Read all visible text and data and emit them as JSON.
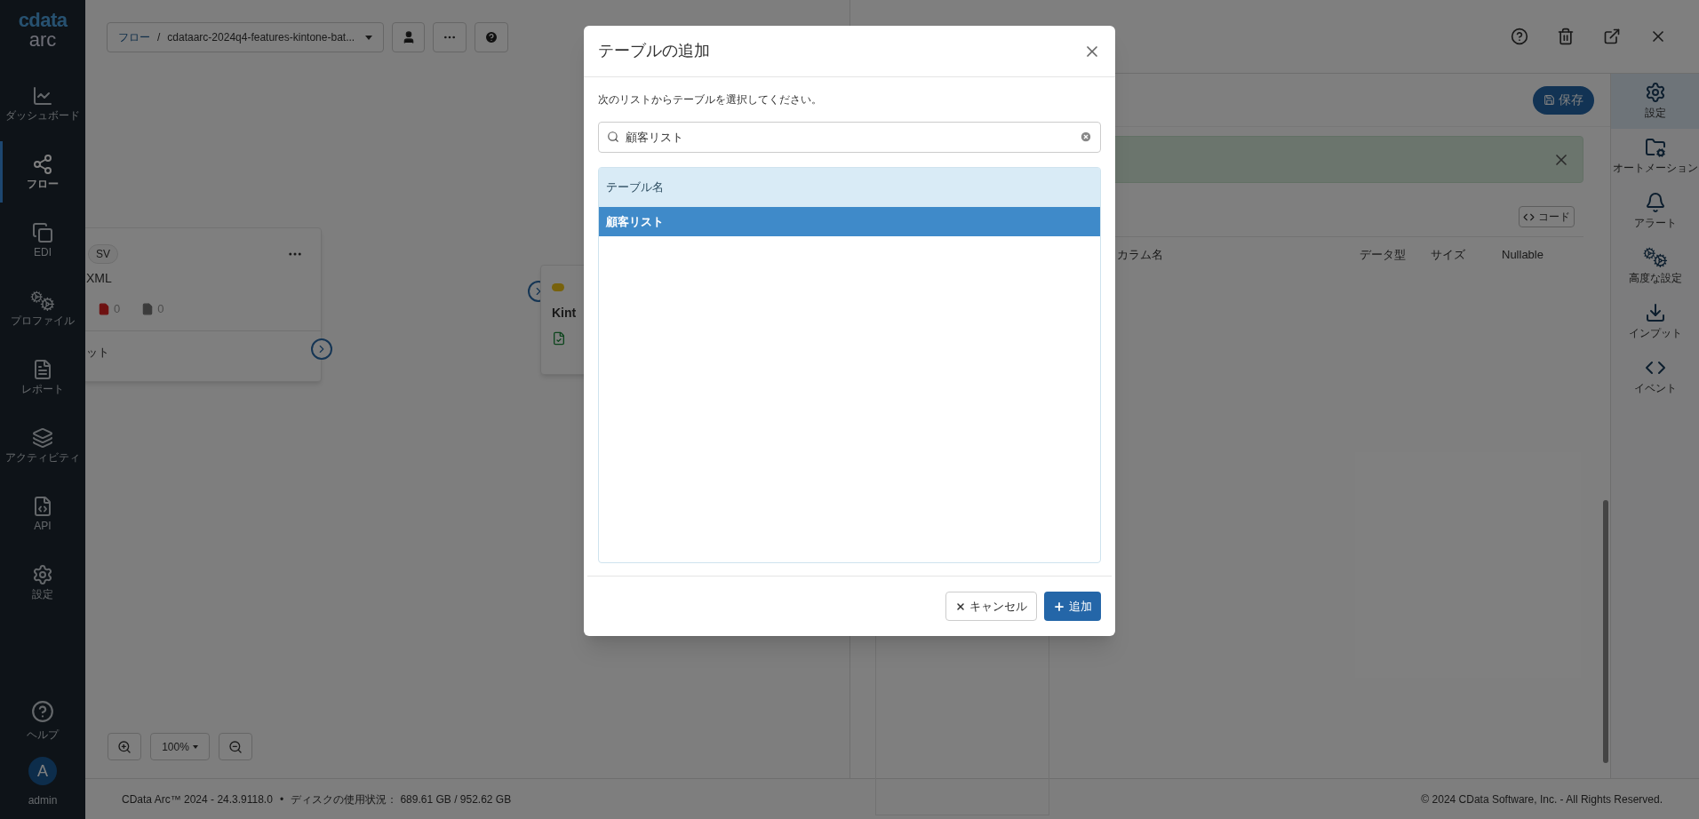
{
  "sidebar": {
    "logo": {
      "brand": "cdata",
      "product": "arc"
    },
    "items": [
      {
        "label": "ダッシュボード",
        "selected": false
      },
      {
        "label": "フロー",
        "selected": true
      },
      {
        "label": "EDI",
        "selected": false
      },
      {
        "label": "プロファイル",
        "selected": false
      },
      {
        "label": "レポート",
        "selected": false
      },
      {
        "label": "アクティビティ",
        "selected": false
      },
      {
        "label": "API",
        "selected": false
      },
      {
        "label": "設定",
        "selected": false
      }
    ],
    "help": "ヘルプ",
    "user": {
      "avatar": "A",
      "name": "admin"
    }
  },
  "toolbar": {
    "breadcrumb_root": "フロー",
    "breadcrumb_separator": "/",
    "flow_name": "cdataarc-2024q4-features-kintone-bat..."
  },
  "canvas": {
    "nodes": [
      {
        "tag": "SV",
        "name": "XML",
        "counts": [
          "0",
          "0"
        ],
        "footer": "ット"
      },
      {
        "name": "Kint"
      }
    ],
    "zoom": "100%"
  },
  "right_panel": {
    "save": "保存",
    "code": "コード",
    "columns": [
      "カラム名",
      "データ型",
      "サイズ",
      "Nullable"
    ],
    "rail": [
      {
        "label": "設定",
        "selected": true
      },
      {
        "label": "オートメーション",
        "selected": false
      },
      {
        "label": "アラート",
        "selected": false
      },
      {
        "label": "高度な設定",
        "selected": false
      },
      {
        "label": "インプット",
        "selected": false
      },
      {
        "label": "イベント",
        "selected": false
      }
    ]
  },
  "dialog": {
    "title": "テーブルの追加",
    "description": "次のリストからテーブルを選択してください。",
    "search": {
      "value": "顧客リスト"
    },
    "columns": [
      "テーブル名"
    ],
    "rows": [
      {
        "name": "顧客リスト",
        "selected": true
      }
    ],
    "cancel": "キャンセル",
    "add": "追加"
  },
  "status_bar": {
    "version": "CData Arc™ 2024 - 24.3.9118.0",
    "separator": "•",
    "disk": "ディスクの使用状況： 689.61 GB / 952.62 GB",
    "copyright": "© 2024 CData Software, Inc. - All Rights Reserved."
  }
}
